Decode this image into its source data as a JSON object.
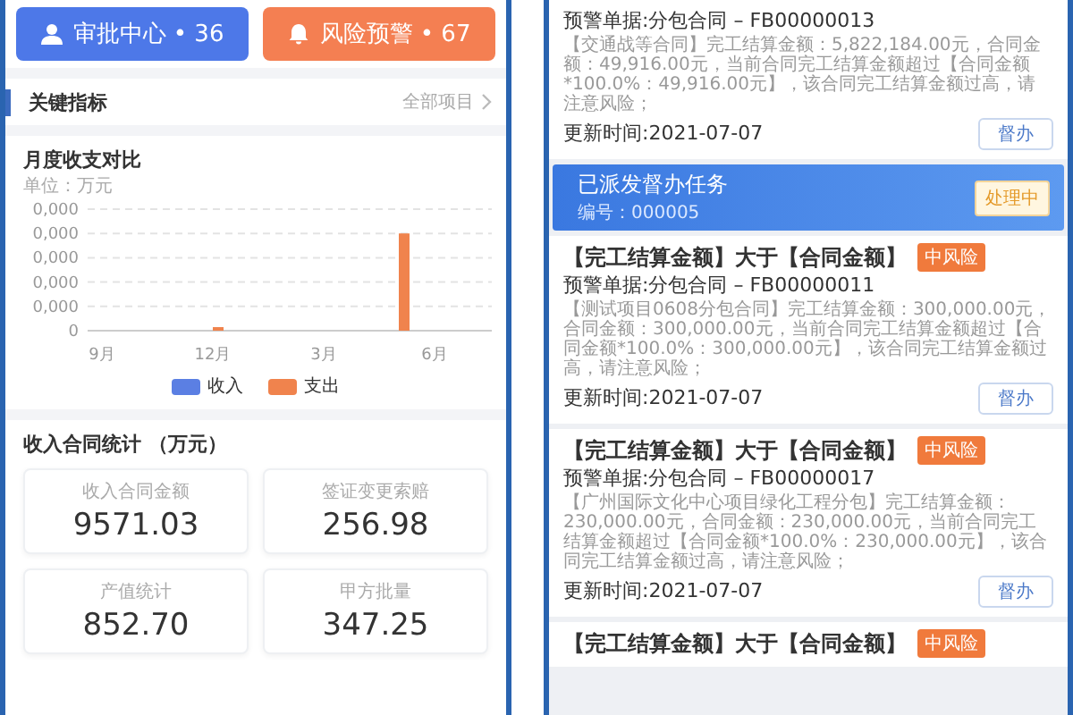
{
  "left_panel": {
    "top_buttons": [
      {
        "kind": "approval",
        "label": "审批中心 • 36"
      },
      {
        "kind": "alert",
        "label": "风险预警 • 67"
      }
    ],
    "section": {
      "title": "关键指标",
      "link": "全部项目"
    },
    "chart_card": {
      "title": "月度收支对比",
      "unit": "单位：万元",
      "y_tick_labels": [
        "0,000",
        "0,000",
        "0,000",
        "0,000",
        "0,000",
        "0"
      ],
      "x_labels": [
        "9月",
        "12月",
        "3月",
        "6月"
      ],
      "legend": [
        {
          "label": "收入",
          "color": "#5b7fe3"
        },
        {
          "label": "支出",
          "color": "#f0834d"
        }
      ]
    },
    "stats": {
      "title": "收入合同统计 （万元）",
      "cards": [
        {
          "label": "收入合同金额",
          "value": "9571.03"
        },
        {
          "label": "签证变更索赔",
          "value": "256.98"
        },
        {
          "label": "产值统计",
          "value": "852.70"
        },
        {
          "label": "甲方批量",
          "value": "347.25"
        }
      ]
    }
  },
  "right_panel": {
    "items": [
      {
        "kind": "warning",
        "document": "预警单据:分包合同 – FB00000013",
        "description": "【交通战等合同】完工结算金额：5,822,184.00元，合同金额：49,916.00元，当前合同完工结算金额超过【合同金额*100.0%：49,916.00元】，该合同完工结算金额过高，请注意风险；",
        "updated": "更新时间:2021-07-07",
        "action": "督办"
      },
      {
        "kind": "dispatch",
        "title": "已派发督办任务",
        "number": "编号：000005",
        "status": "处理中"
      },
      {
        "kind": "warning",
        "title": "【完工结算金额】大于【合同金额】",
        "risk": "中风险",
        "document": "预警单据:分包合同 – FB00000011",
        "description": "【测试项目0608分包合同】完工结算金额：300,000.00元，合同金额：300,000.00元，当前合同完工结算金额超过【合同金额*100.0%：300,000.00元】，该合同完工结算金额过高，请注意风险；",
        "updated": "更新时间:2021-07-07",
        "action": "督办"
      },
      {
        "kind": "warning",
        "title": "【完工结算金额】大于【合同金额】",
        "risk": "中风险",
        "document": "预警单据:分包合同 – FB00000017",
        "description": "【广州国际文化中心项目绿化工程分包】完工结算金额：230,000.00元，合同金额：230,000.00元，当前合同完工结算金额超过【合同金额*100.0%：230,000.00元】，该合同完工结算金额过高，请注意风险；",
        "updated": "更新时间:2021-07-07",
        "action": "督办"
      },
      {
        "kind": "warning",
        "title": "【完工结算金额】大于【合同金额】",
        "risk": "中风险"
      }
    ]
  }
}
